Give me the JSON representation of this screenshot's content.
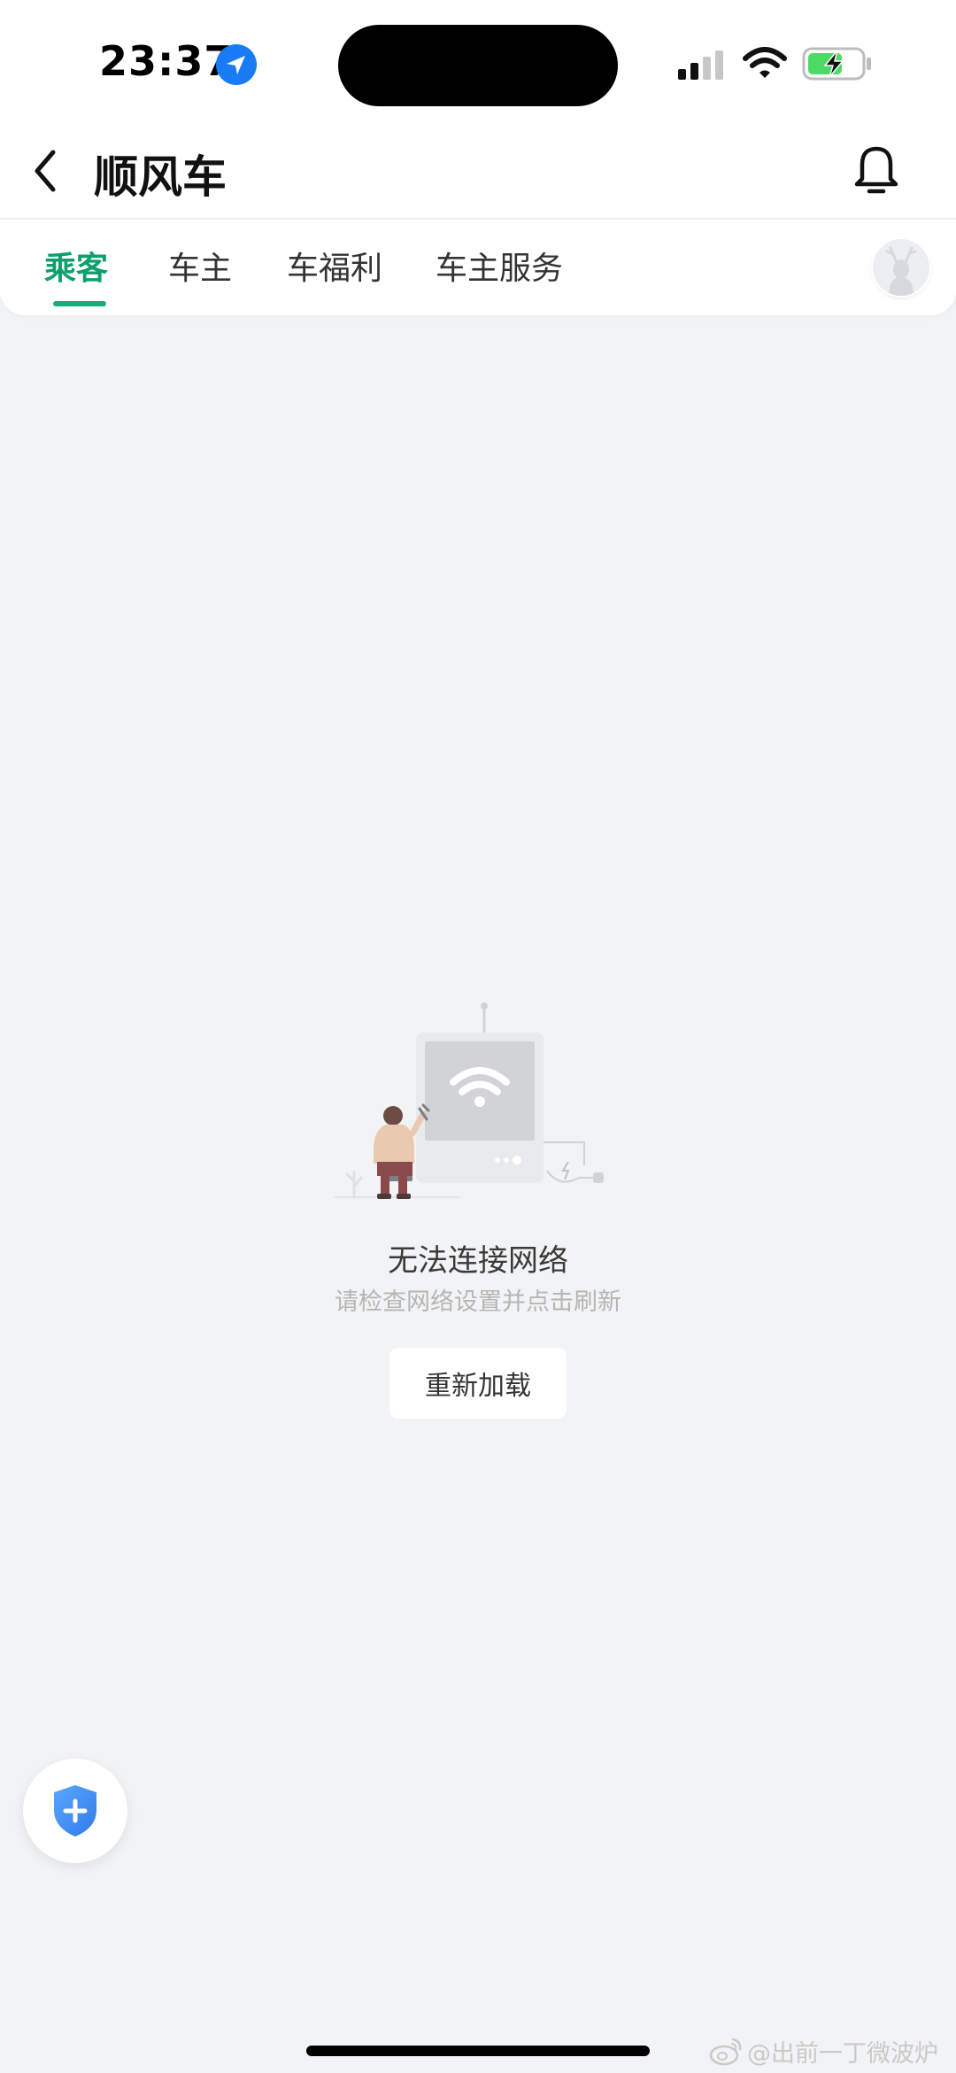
{
  "status_bar": {
    "time": "23:37",
    "icons": [
      "location-arrow-icon",
      "cellular-signal-icon",
      "wifi-icon",
      "battery-charging-icon"
    ]
  },
  "header": {
    "title": "顺风车",
    "back_icon": "chevron-left-icon",
    "notification_icon": "bell-icon"
  },
  "tabs": [
    {
      "label": "乘客",
      "active": true
    },
    {
      "label": "车主",
      "active": false
    },
    {
      "label": "车福利",
      "active": false
    },
    {
      "label": "车主服务",
      "active": false
    }
  ],
  "error_state": {
    "illustration": "network-repair-illustration",
    "title": "无法连接网络",
    "subtitle": "请检查网络设置并点击刷新",
    "reload_label": "重新加载"
  },
  "safety_button": {
    "icon": "shield-plus-icon"
  },
  "watermark": {
    "icon": "weibo-icon",
    "text": "@出前一丁微波炉"
  },
  "colors": {
    "accent": "#11b27a",
    "active_tab_text": "#0ea06b",
    "background": "#f2f3f5",
    "shield": "#3f8ef2",
    "battery_charge": "#4cd964",
    "location": "#1a7cf5"
  }
}
